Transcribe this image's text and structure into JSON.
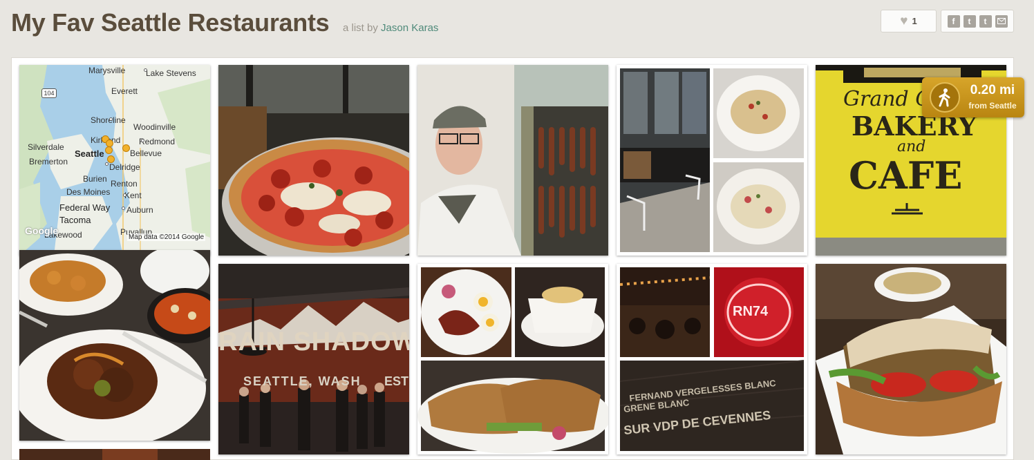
{
  "header": {
    "title": "My Fav Seattle Restaurants",
    "byline_prefix": "a list by",
    "author": "Jason Karas",
    "like_count": "1",
    "share_icons": [
      "facebook-icon",
      "twitter-icon",
      "tumblr-icon",
      "email-icon"
    ]
  },
  "distance_badge": {
    "value": "0.20 mi",
    "from": "from Seattle",
    "icon": "walking-person-icon"
  },
  "map": {
    "places": [
      "Marysville",
      "Lake Stevens",
      "Everett",
      "Shoreline",
      "Woodinville",
      "Kirkland",
      "Redmond",
      "Silverdale",
      "Seattle",
      "Bellevue",
      "Bremerton",
      "Delridge",
      "Burien",
      "Renton",
      "Des Moines",
      "Kent",
      "Federal Way",
      "Auburn",
      "Tacoma",
      "Puyallup",
      "Lakewood"
    ],
    "highway": "104",
    "attribution": "Map data ©2014 Google",
    "logo": "Google"
  },
  "tiles": [
    {
      "name": "pizza-photo"
    },
    {
      "name": "salumi-chef-photo"
    },
    {
      "name": "tinello-collage"
    },
    {
      "name": "grand-central-bakery-photo",
      "sign_lines": [
        "Grand C",
        "BAKERY",
        "and",
        "CAFE"
      ]
    },
    {
      "name": "chinese-food-photo"
    },
    {
      "name": "rain-shadow-mural-photo",
      "mural_lines": [
        "RAIN SHADOW",
        "SEATTLE, WASH",
        "EST"
      ]
    },
    {
      "name": "brunch-collage"
    },
    {
      "name": "wine-bar-collage",
      "wine_lines": [
        "FERNAND VERGELESSES BLANC",
        "GRENE BLANC",
        "SUR VDP DE CEVENNES"
      ],
      "neon": "RN74"
    },
    {
      "name": "sandwich-photo"
    }
  ],
  "colors": {
    "title": "#5a4d3c",
    "author_link": "#4f8a7a",
    "badge": "#c8951d"
  }
}
